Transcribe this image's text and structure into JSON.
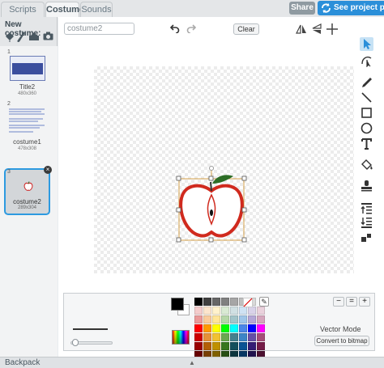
{
  "tabs": [
    {
      "label": "Scripts",
      "active": false
    },
    {
      "label": "Costumes",
      "active": true
    },
    {
      "label": "Sounds",
      "active": false
    }
  ],
  "header": {
    "share_label": "Share",
    "see_project_label": "See project page"
  },
  "sidebar": {
    "new_costume_label": "New costume:",
    "new_icons": [
      "paint-brush-icon",
      "pencil-icon",
      "folder-upload-icon",
      "camera-icon"
    ],
    "costumes": [
      {
        "number": "1",
        "name": "Title2",
        "size": "480x360",
        "selected": false
      },
      {
        "number": "2",
        "name": "costume1",
        "size": "478x308",
        "selected": false
      },
      {
        "number": "3",
        "name": "costume2",
        "size": "289x304",
        "selected": true
      }
    ]
  },
  "editor": {
    "costume_name_value": "costume2",
    "clear_label": "Clear",
    "tools": [
      "select-icon",
      "reshape-icon",
      "pencil-icon",
      "line-icon",
      "rectangle-icon",
      "ellipse-icon",
      "text-icon",
      "color-fill-icon",
      "stamp-icon",
      "forward-layer-icon",
      "back-layer-icon",
      "group-icon"
    ]
  },
  "bottom": {
    "mode_label": "Vector Mode",
    "convert_label": "Convert to bitmap",
    "primary_color": "#000000",
    "secondary_color": "#ffffff",
    "palette": [
      "#000000",
      "#404040",
      "#666666",
      "#808080",
      "#a6a6a6",
      "#bfbfbf",
      "#d9d9d9",
      "#ffffff",
      "#f4cccc",
      "#fce5cd",
      "#fff2cc",
      "#d9ead3",
      "#d0e0e3",
      "#cfe2f3",
      "#d9d2e9",
      "#ead1dc",
      "#ea9999",
      "#f9cb9c",
      "#ffe599",
      "#b6d7a8",
      "#a2c4c9",
      "#9fc5e8",
      "#b4a7d6",
      "#d5a6bd",
      "#ff0000",
      "#ff9900",
      "#ffff00",
      "#00ff00",
      "#00ffff",
      "#4a86e8",
      "#0000ff",
      "#ff00ff",
      "#cc0000",
      "#e69138",
      "#f1c232",
      "#6aa84f",
      "#45818e",
      "#3d85c6",
      "#674ea7",
      "#a64d79",
      "#990000",
      "#b45f06",
      "#bf9000",
      "#38761d",
      "#134f5c",
      "#0b5394",
      "#351c75",
      "#741b47",
      "#660000",
      "#783f04",
      "#7f6000",
      "#274e13",
      "#0c343d",
      "#073763",
      "#20124d",
      "#4c1130"
    ]
  },
  "backpack": {
    "label": "Backpack"
  }
}
